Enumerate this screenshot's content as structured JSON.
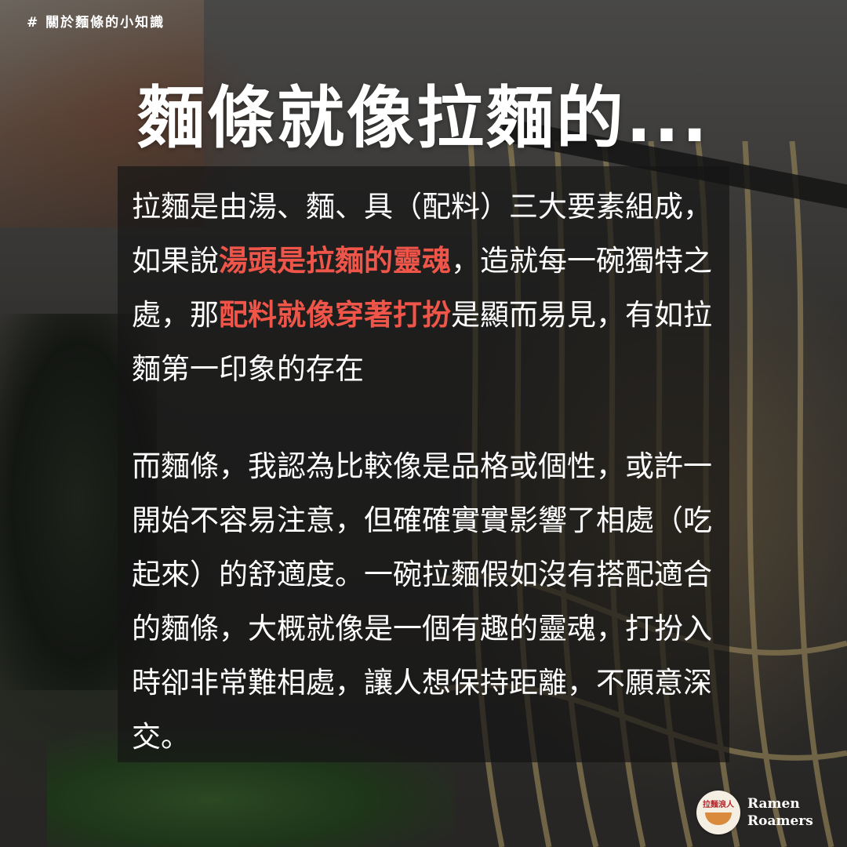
{
  "hashtag": "# 關於麵條的小知識",
  "title": "麵條就像拉麵的...",
  "paragraph1": {
    "segments": [
      {
        "text": "拉麵是由湯、麵、具（配料）三大要素組成，如果說",
        "highlight": false
      },
      {
        "text": "湯頭是拉麵的靈魂",
        "highlight": true
      },
      {
        "text": "，造就每一碗獨特之處，那",
        "highlight": false
      },
      {
        "text": "配料就像穿著打扮",
        "highlight": true
      },
      {
        "text": "是顯而易見，有如拉麵第一印象的存在",
        "highlight": false
      }
    ]
  },
  "paragraph2": "而麵條，我認為比較像是品格或個性，或許一開始不容易注意，但確確實實影響了相處（吃起來）的舒適度。一碗拉麵假如沒有搭配適合的麵條，大概就像是一個有趣的靈魂，打扮入時卻非常難相處，讓人想保持距離，不願意深交。",
  "brand": {
    "logo_text": "拉麵浪人",
    "name_line1": "Ramen",
    "name_line2": "Roamers"
  },
  "colors": {
    "highlight": "#f0554a",
    "text": "#ffffff",
    "panel": "rgba(20,20,20,0.68)"
  }
}
